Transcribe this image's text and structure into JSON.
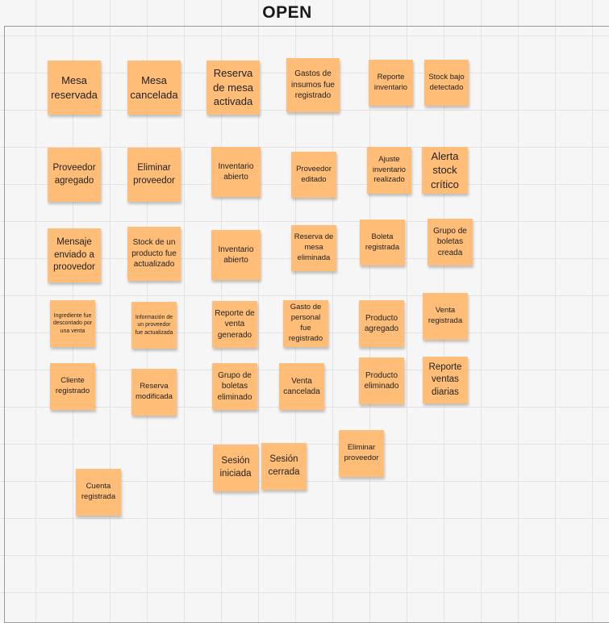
{
  "board": {
    "title": "OPEN"
  },
  "notes": [
    {
      "text": "Mesa reservada"
    },
    {
      "text": "Mesa cancelada"
    },
    {
      "text": "Reserva de mesa activada"
    },
    {
      "text": "Gastos de insumos fue registrado"
    },
    {
      "text": "Reporte inventario"
    },
    {
      "text": "Stock bajo detectado"
    },
    {
      "text": "Proveedor agregado"
    },
    {
      "text": "Eliminar proveedor"
    },
    {
      "text": "Inventario abierto"
    },
    {
      "text": "Proveedor editado"
    },
    {
      "text": "Ajuste inventario realizado"
    },
    {
      "text": "Alerta stock crítico"
    },
    {
      "text": "Mensaje enviado a proovedor"
    },
    {
      "text": "Stock de un producto fue actualizado"
    },
    {
      "text": "Inventario abierto"
    },
    {
      "text": "Reserva de mesa eliminada"
    },
    {
      "text": "Boleta registrada"
    },
    {
      "text": "Grupo de boletas creada"
    },
    {
      "text": "Ingrediente fue descontado por una venta"
    },
    {
      "text": "Información de un proveedor fue actualizada"
    },
    {
      "text": "Reporte de venta generado"
    },
    {
      "text": "Gasto de personal fue registrado"
    },
    {
      "text": "Producto agregado"
    },
    {
      "text": "Venta registrada"
    },
    {
      "text": "Cliente registrado"
    },
    {
      "text": "Reserva modificada"
    },
    {
      "text": "Grupo de boletas eliminado"
    },
    {
      "text": "Venta cancelada"
    },
    {
      "text": "Producto eliminado"
    },
    {
      "text": "Reporte ventas diarias"
    },
    {
      "text": "Sesión iniciada"
    },
    {
      "text": "Sesión cerrada"
    },
    {
      "text": "Eliminar proveedor"
    },
    {
      "text": "Cuenta registrada"
    }
  ]
}
